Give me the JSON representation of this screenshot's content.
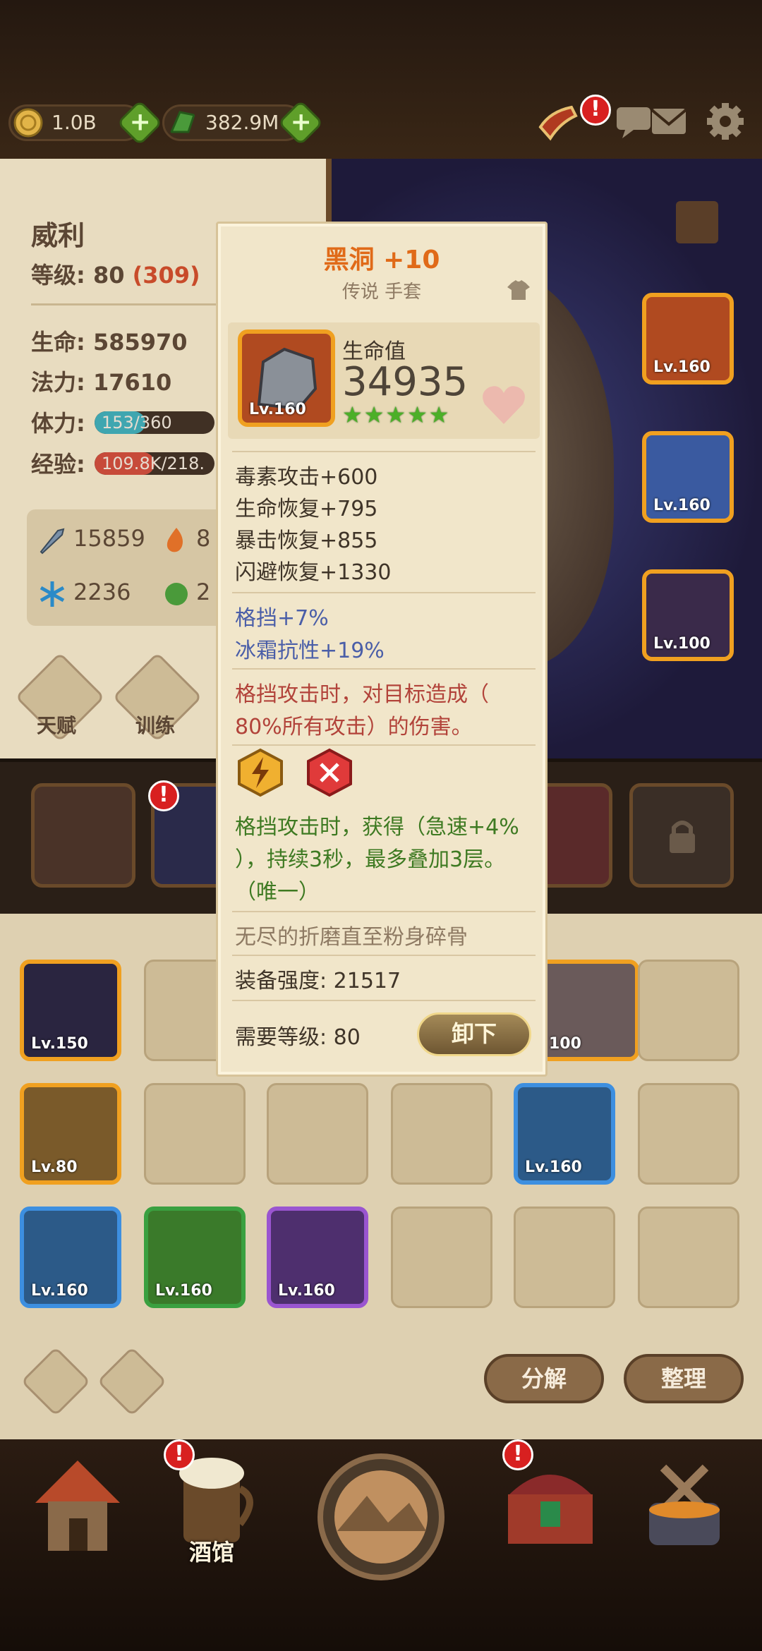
{
  "resources": {
    "gold": "1.0B",
    "gems": "382.9M"
  },
  "hero": {
    "name": "威利",
    "level_label": "等级:",
    "level": "80",
    "level_extra": "(309)",
    "hp_label": "生命:",
    "hp": "585970",
    "mana_label": "法力:",
    "mana": "17610",
    "stamina_label": "体力:",
    "stamina": "153/360",
    "stamina_fraction": 0.425,
    "exp_label": "经验:",
    "exp": "109.8K/218.",
    "exp_fraction": 0.5,
    "attack": "15859",
    "attack2": "8",
    "defense": "2236",
    "defense2": "2",
    "talent_label": "天赋",
    "train_label": "训练"
  },
  "tooltip": {
    "name": "黑洞 +10",
    "type": "传说 手套",
    "stat_label": "生命值",
    "stat_value": "34935",
    "stars": 5,
    "item_level": "Lv.160",
    "attrs": [
      "毒素攻击+600",
      "生命恢复+795",
      "暴击恢复+855",
      "闪避恢复+1330"
    ],
    "bonus": [
      "格挡+7%",
      "冰霜抗性+19%"
    ],
    "effect1": [
      "格挡攻击时，对目标造成（",
      "80%所有攻击）的伤害。"
    ],
    "effect2": [
      "格挡攻击时，获得（急速+4%",
      "），持续3秒，最多叠加3层。",
      "（唯一）"
    ],
    "flavor": "无尽的折磨直至粉身碎骨",
    "power_label": "装备强度:",
    "power": "21517",
    "req_label": "需要等级:",
    "req_level": "80",
    "unequip": "卸下"
  },
  "equipped_levels": [
    "Lv.160",
    "Lv.160",
    "Lv.100"
  ],
  "inventory": {
    "items": [
      {
        "level": "Lv.150"
      },
      {
        "level": "100"
      },
      {
        "level": "Lv.80"
      },
      {
        "level": "Lv.160"
      },
      {
        "level": "Lv.160"
      },
      {
        "level": "Lv.160"
      },
      {
        "level": "Lv.160"
      }
    ],
    "decompose": "分解",
    "organize": "整理"
  },
  "nav": {
    "tavern": "酒馆"
  },
  "colors": {
    "accent_orange": "#e06a18",
    "blue_text": "#4a5ea8",
    "red_text": "#b2433a",
    "green_text": "#3e7a22",
    "star_green": "#4caf28"
  }
}
